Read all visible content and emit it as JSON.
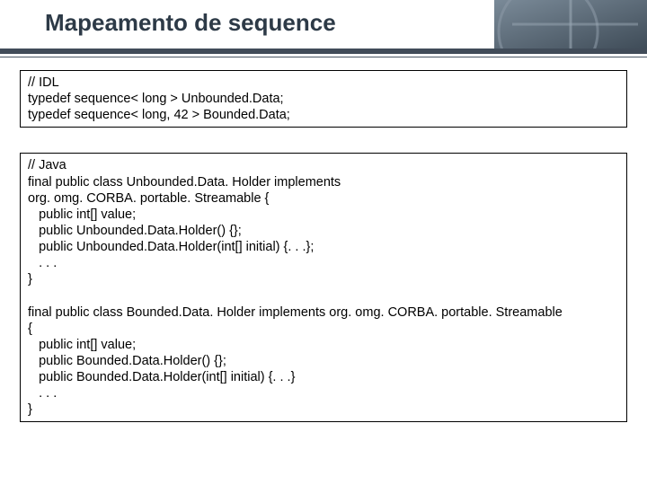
{
  "header": {
    "title": "Mapeamento de sequence"
  },
  "code": {
    "idl": "// IDL\ntypedef sequence< long > Unbounded.Data;\ntypedef sequence< long, 42 > Bounded.Data;",
    "java": "// Java\nfinal public class Unbounded.Data. Holder implements\norg. omg. CORBA. portable. Streamable {\n   public int[] value;\n   public Unbounded.Data.Holder() {};\n   public Unbounded.Data.Holder(int[] initial) {. . .};\n   . . .\n}\n\nfinal public class Bounded.Data. Holder implements org. omg. CORBA. portable. Streamable\n{\n   public int[] value;\n   public Bounded.Data.Holder() {};\n   public Bounded.Data.Holder(int[] initial) {. . .}\n   . . .\n}"
  }
}
